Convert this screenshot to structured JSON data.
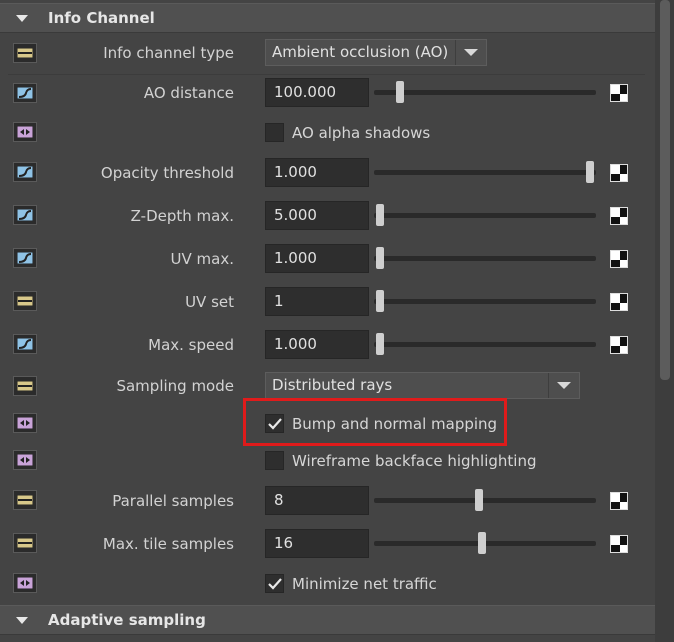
{
  "sections": {
    "info_channel_title": "Info Channel",
    "adaptive_sampling_title": "Adaptive sampling"
  },
  "rows": {
    "info_channel_type": {
      "label": "Info channel type",
      "value": "Ambient occlusion (AO)"
    },
    "ao_distance": {
      "label": "AO distance",
      "value": "100.000",
      "slider_fraction": 0.12
    },
    "ao_alpha_shadows": {
      "label": "AO alpha shadows",
      "checked": false
    },
    "opacity_threshold": {
      "label": "Opacity threshold",
      "value": "1.000",
      "slider_fraction": 1.0
    },
    "z_depth_max": {
      "label": "Z-Depth max.",
      "value": "5.000",
      "slider_fraction": 0.0
    },
    "uv_max": {
      "label": "UV max.",
      "value": "1.000",
      "slider_fraction": 0.0
    },
    "uv_set": {
      "label": "UV set",
      "value": "1",
      "slider_fraction": 0.0
    },
    "max_speed": {
      "label": "Max. speed",
      "value": "1.000",
      "slider_fraction": 0.0
    },
    "sampling_mode": {
      "label": "Sampling mode",
      "value": "Distributed rays"
    },
    "bump_normal_mapping": {
      "label": "Bump and normal mapping",
      "checked": true
    },
    "wireframe_backface": {
      "label": "Wireframe backface highlighting",
      "checked": false
    },
    "parallel_samples": {
      "label": "Parallel samples",
      "value": "8",
      "slider_fraction": 0.47
    },
    "max_tile_samples": {
      "label": "Max. tile samples",
      "value": "16",
      "slider_fraction": 0.49
    },
    "minimize_net_traffic": {
      "label": "Minimize net traffic",
      "checked": true
    }
  },
  "colors": {
    "background": "#444444",
    "highlight": "#e01b1b"
  }
}
